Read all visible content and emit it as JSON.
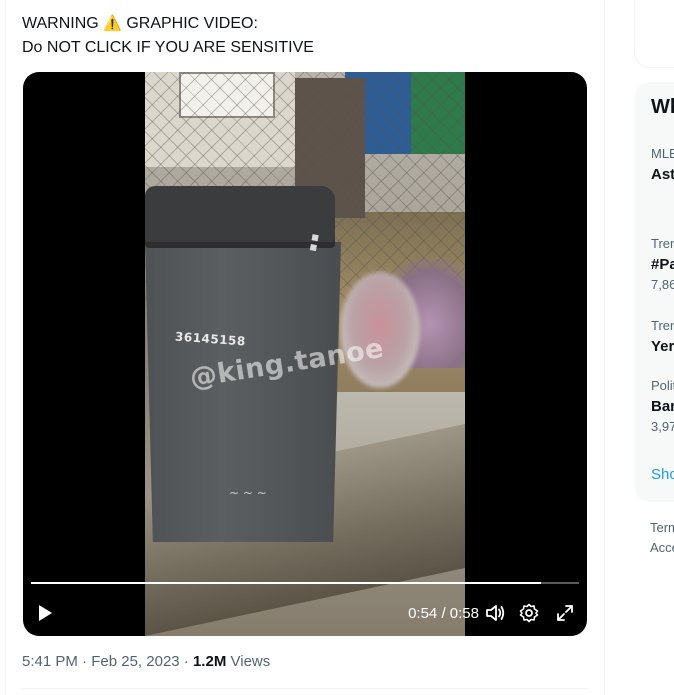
{
  "tweet": {
    "line1_before": "WARNING",
    "line1_emoji": "⚠️",
    "line1_after": "GRAPHIC VIDEO:",
    "line2": "Do NOT CLICK IF YOU ARE SENSITIVE",
    "meta_time": "5:41 PM",
    "meta_sep1": "·",
    "meta_date": "Feb 25, 2023",
    "meta_sep2": "·",
    "views_count": "1.2M",
    "views_label": "Views"
  },
  "video": {
    "watermark": "@king.tanoe",
    "bin_number": "36145158",
    "current_time": "0:54",
    "time_separator": "/",
    "duration": "0:58",
    "progress_fraction": 0.931,
    "icons": {
      "play": "play-icon",
      "volume": "volume-icon",
      "settings": "gear-icon",
      "fullscreen": "fullscreen-icon"
    }
  },
  "sidebar": {
    "heading": "Wh",
    "trends": [
      {
        "category": "MLE",
        "name": "Ast",
        "count": ""
      },
      {
        "category": "Tren",
        "name": "#Pa",
        "count": "7,86"
      },
      {
        "category": "Tren",
        "name": "Yer",
        "count": ""
      },
      {
        "category": "Polit",
        "name": "Bar",
        "count": "3,97"
      }
    ],
    "show_more": "Sho",
    "footer_line1": "Term",
    "footer_line2": "Acce"
  },
  "colors": {
    "accent": "#1d9bf0",
    "secondary_text": "#536471",
    "primary_text": "#0f1419"
  }
}
